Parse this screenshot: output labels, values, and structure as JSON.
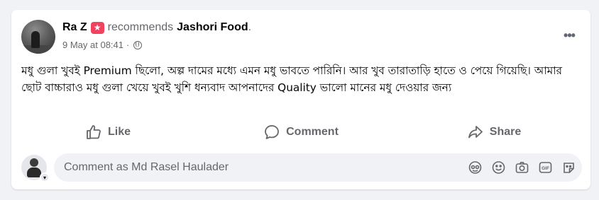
{
  "post": {
    "author": "Ra Z",
    "recommend_icon": "star-recommend-icon",
    "recommends_text": "recommends",
    "page_name": "Jashori Food",
    "period": ".",
    "timestamp": "9 May at 08:41",
    "separator": "·",
    "privacy_icon": "globe-icon",
    "more_label": "•••",
    "text": "মধু গুলা খুবই Premium ছিলো, অল্প দামের মধ্যে এমন মধু ভাবতে পারিনি। আর খুব তারাতাড়ি হাতে ও পেয়ে গিয়েছি। আমার ছোট বাচ্চারাও মধু গুলা খেয়ে খুবই খুশি ধন্যবাদ আপনাদের Quality ভালো মানের মধু দেওয়ার জন্য"
  },
  "actions": {
    "like": "Like",
    "comment": "Comment",
    "share": "Share"
  },
  "composer": {
    "placeholder": "Comment as Md Rasel Haulader",
    "tools": [
      "avatar-sticker-icon",
      "emoji-icon",
      "camera-icon",
      "gif-icon",
      "sticker-icon"
    ]
  },
  "colors": {
    "recommend_red": "#f3425f",
    "secondary_text": "#65676b",
    "background": "#f0f2f5"
  }
}
